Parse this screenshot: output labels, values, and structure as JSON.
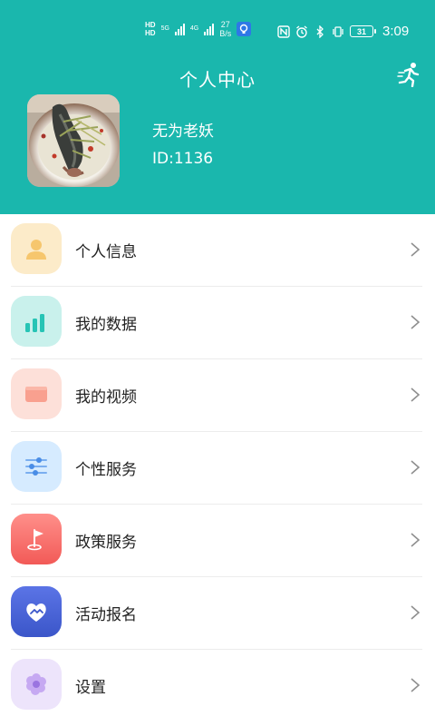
{
  "status_bar": {
    "hd_1": "HD",
    "hd_2": "HD",
    "net_1": "5G",
    "net_2": "4G",
    "speed_value": "27",
    "speed_unit": "B/s",
    "battery": "31",
    "time": "3:09"
  },
  "header": {
    "title": "个人中心"
  },
  "profile": {
    "name": "无为老妖",
    "id": "ID:1136"
  },
  "menu": {
    "items": [
      {
        "label": "个人信息",
        "icon": "person-icon"
      },
      {
        "label": "我的数据",
        "icon": "bar-chart-icon"
      },
      {
        "label": "我的视频",
        "icon": "video-icon"
      },
      {
        "label": "个性服务",
        "icon": "sliders-icon"
      },
      {
        "label": "政策服务",
        "icon": "flag-icon"
      },
      {
        "label": "活动报名",
        "icon": "heart-hand-icon"
      },
      {
        "label": "设置",
        "icon": "gear-icon"
      }
    ]
  },
  "colors": {
    "header_bg": "#1ab7ad",
    "divider": "#ececec"
  }
}
